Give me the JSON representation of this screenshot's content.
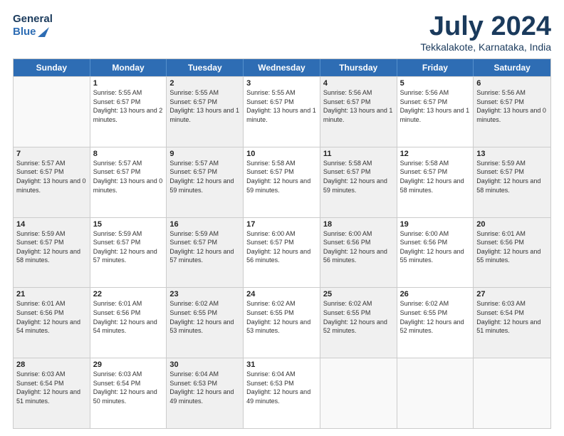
{
  "header": {
    "logo_line1": "General",
    "logo_line2": "Blue",
    "month_title": "July 2024",
    "location": "Tekkalakote, Karnataka, India"
  },
  "days_of_week": [
    "Sunday",
    "Monday",
    "Tuesday",
    "Wednesday",
    "Thursday",
    "Friday",
    "Saturday"
  ],
  "weeks": [
    [
      {
        "date": "",
        "sunrise": "",
        "sunset": "",
        "daylight": "",
        "empty": true
      },
      {
        "date": "1",
        "sunrise": "Sunrise: 5:55 AM",
        "sunset": "Sunset: 6:57 PM",
        "daylight": "Daylight: 13 hours and 2 minutes."
      },
      {
        "date": "2",
        "sunrise": "Sunrise: 5:55 AM",
        "sunset": "Sunset: 6:57 PM",
        "daylight": "Daylight: 13 hours and 1 minute."
      },
      {
        "date": "3",
        "sunrise": "Sunrise: 5:55 AM",
        "sunset": "Sunset: 6:57 PM",
        "daylight": "Daylight: 13 hours and 1 minute."
      },
      {
        "date": "4",
        "sunrise": "Sunrise: 5:56 AM",
        "sunset": "Sunset: 6:57 PM",
        "daylight": "Daylight: 13 hours and 1 minute."
      },
      {
        "date": "5",
        "sunrise": "Sunrise: 5:56 AM",
        "sunset": "Sunset: 6:57 PM",
        "daylight": "Daylight: 13 hours and 1 minute."
      },
      {
        "date": "6",
        "sunrise": "Sunrise: 5:56 AM",
        "sunset": "Sunset: 6:57 PM",
        "daylight": "Daylight: 13 hours and 0 minutes."
      }
    ],
    [
      {
        "date": "7",
        "sunrise": "Sunrise: 5:57 AM",
        "sunset": "Sunset: 6:57 PM",
        "daylight": "Daylight: 13 hours and 0 minutes."
      },
      {
        "date": "8",
        "sunrise": "Sunrise: 5:57 AM",
        "sunset": "Sunset: 6:57 PM",
        "daylight": "Daylight: 13 hours and 0 minutes."
      },
      {
        "date": "9",
        "sunrise": "Sunrise: 5:57 AM",
        "sunset": "Sunset: 6:57 PM",
        "daylight": "Daylight: 12 hours and 59 minutes."
      },
      {
        "date": "10",
        "sunrise": "Sunrise: 5:58 AM",
        "sunset": "Sunset: 6:57 PM",
        "daylight": "Daylight: 12 hours and 59 minutes."
      },
      {
        "date": "11",
        "sunrise": "Sunrise: 5:58 AM",
        "sunset": "Sunset: 6:57 PM",
        "daylight": "Daylight: 12 hours and 59 minutes."
      },
      {
        "date": "12",
        "sunrise": "Sunrise: 5:58 AM",
        "sunset": "Sunset: 6:57 PM",
        "daylight": "Daylight: 12 hours and 58 minutes."
      },
      {
        "date": "13",
        "sunrise": "Sunrise: 5:59 AM",
        "sunset": "Sunset: 6:57 PM",
        "daylight": "Daylight: 12 hours and 58 minutes."
      }
    ],
    [
      {
        "date": "14",
        "sunrise": "Sunrise: 5:59 AM",
        "sunset": "Sunset: 6:57 PM",
        "daylight": "Daylight: 12 hours and 58 minutes."
      },
      {
        "date": "15",
        "sunrise": "Sunrise: 5:59 AM",
        "sunset": "Sunset: 6:57 PM",
        "daylight": "Daylight: 12 hours and 57 minutes."
      },
      {
        "date": "16",
        "sunrise": "Sunrise: 5:59 AM",
        "sunset": "Sunset: 6:57 PM",
        "daylight": "Daylight: 12 hours and 57 minutes."
      },
      {
        "date": "17",
        "sunrise": "Sunrise: 6:00 AM",
        "sunset": "Sunset: 6:57 PM",
        "daylight": "Daylight: 12 hours and 56 minutes."
      },
      {
        "date": "18",
        "sunrise": "Sunrise: 6:00 AM",
        "sunset": "Sunset: 6:56 PM",
        "daylight": "Daylight: 12 hours and 56 minutes."
      },
      {
        "date": "19",
        "sunrise": "Sunrise: 6:00 AM",
        "sunset": "Sunset: 6:56 PM",
        "daylight": "Daylight: 12 hours and 55 minutes."
      },
      {
        "date": "20",
        "sunrise": "Sunrise: 6:01 AM",
        "sunset": "Sunset: 6:56 PM",
        "daylight": "Daylight: 12 hours and 55 minutes."
      }
    ],
    [
      {
        "date": "21",
        "sunrise": "Sunrise: 6:01 AM",
        "sunset": "Sunset: 6:56 PM",
        "daylight": "Daylight: 12 hours and 54 minutes."
      },
      {
        "date": "22",
        "sunrise": "Sunrise: 6:01 AM",
        "sunset": "Sunset: 6:56 PM",
        "daylight": "Daylight: 12 hours and 54 minutes."
      },
      {
        "date": "23",
        "sunrise": "Sunrise: 6:02 AM",
        "sunset": "Sunset: 6:55 PM",
        "daylight": "Daylight: 12 hours and 53 minutes."
      },
      {
        "date": "24",
        "sunrise": "Sunrise: 6:02 AM",
        "sunset": "Sunset: 6:55 PM",
        "daylight": "Daylight: 12 hours and 53 minutes."
      },
      {
        "date": "25",
        "sunrise": "Sunrise: 6:02 AM",
        "sunset": "Sunset: 6:55 PM",
        "daylight": "Daylight: 12 hours and 52 minutes."
      },
      {
        "date": "26",
        "sunrise": "Sunrise: 6:02 AM",
        "sunset": "Sunset: 6:55 PM",
        "daylight": "Daylight: 12 hours and 52 minutes."
      },
      {
        "date": "27",
        "sunrise": "Sunrise: 6:03 AM",
        "sunset": "Sunset: 6:54 PM",
        "daylight": "Daylight: 12 hours and 51 minutes."
      }
    ],
    [
      {
        "date": "28",
        "sunrise": "Sunrise: 6:03 AM",
        "sunset": "Sunset: 6:54 PM",
        "daylight": "Daylight: 12 hours and 51 minutes."
      },
      {
        "date": "29",
        "sunrise": "Sunrise: 6:03 AM",
        "sunset": "Sunset: 6:54 PM",
        "daylight": "Daylight: 12 hours and 50 minutes."
      },
      {
        "date": "30",
        "sunrise": "Sunrise: 6:04 AM",
        "sunset": "Sunset: 6:53 PM",
        "daylight": "Daylight: 12 hours and 49 minutes."
      },
      {
        "date": "31",
        "sunrise": "Sunrise: 6:04 AM",
        "sunset": "Sunset: 6:53 PM",
        "daylight": "Daylight: 12 hours and 49 minutes."
      },
      {
        "date": "",
        "sunrise": "",
        "sunset": "",
        "daylight": "",
        "empty": true
      },
      {
        "date": "",
        "sunrise": "",
        "sunset": "",
        "daylight": "",
        "empty": true
      },
      {
        "date": "",
        "sunrise": "",
        "sunset": "",
        "daylight": "",
        "empty": true
      }
    ]
  ]
}
